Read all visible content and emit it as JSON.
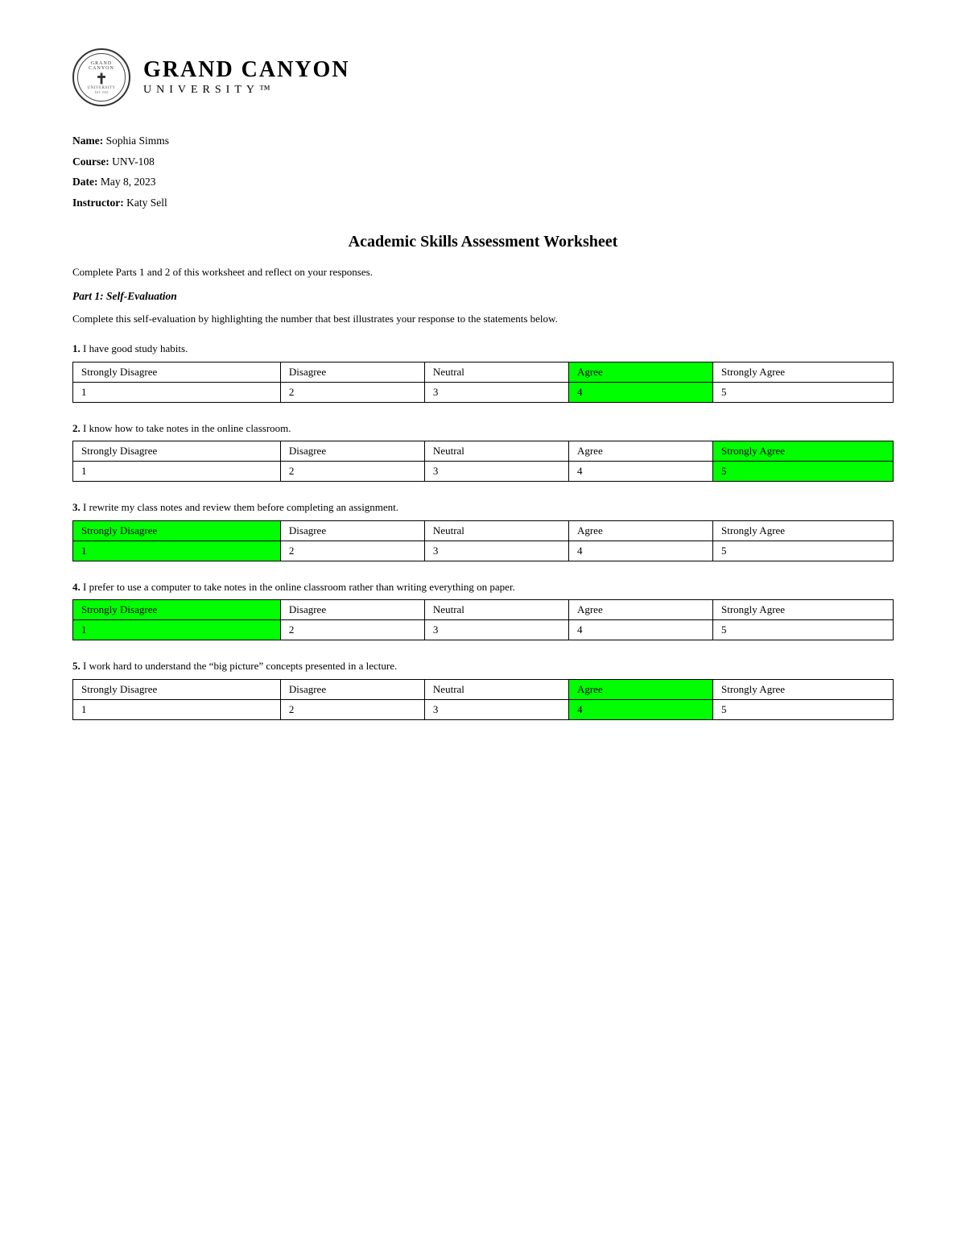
{
  "header": {
    "university_line1": "GRAND CANYON",
    "university_line2": "UNIVERSITY™"
  },
  "meta": {
    "name_label": "Name:",
    "name_value": "Sophia Simms",
    "course_label": "Course:",
    "course_value": "UNV-108",
    "date_label": "Date:",
    "date_value": "May 8, 2023",
    "instructor_label": "Instructor:",
    "instructor_value": "Katy Sell"
  },
  "title": "Academic Skills Assessment Worksheet",
  "instruction": "Complete Parts 1 and 2 of this worksheet and reflect on your responses.",
  "part1": {
    "heading": "Part 1: Self-Evaluation",
    "instruction": "Complete this self-evaluation by highlighting the number that best illustrates your response to the statements below.",
    "questions": [
      {
        "number": "1",
        "text": "I have good study habits.",
        "headers": [
          "Strongly Disagree",
          "Disagree",
          "Neutral",
          "Agree",
          "Strongly Agree"
        ],
        "values": [
          "1",
          "2",
          "3",
          "4",
          "5"
        ],
        "highlighted_header": -1,
        "highlighted_value": 3,
        "header_highlight": 3
      },
      {
        "number": "2",
        "text": "I know how to take notes in the online classroom.",
        "headers": [
          "Strongly Disagree",
          "Disagree",
          "Neutral",
          "Agree",
          "Strongly Agree"
        ],
        "values": [
          "1",
          "2",
          "3",
          "4",
          "5"
        ],
        "highlighted_header": 4,
        "highlighted_value": 4,
        "header_highlight": 4
      },
      {
        "number": "3",
        "text": "I rewrite my class notes and review them before completing an assignment.",
        "headers": [
          "Strongly Disagree",
          "Disagree",
          "Neutral",
          "Agree",
          "Strongly Agree"
        ],
        "values": [
          "1",
          "2",
          "3",
          "4",
          "5"
        ],
        "highlighted_header": 0,
        "highlighted_value": 0,
        "header_highlight": 0
      },
      {
        "number": "4",
        "text": "I prefer to use a computer to take notes in the online classroom rather than writing everything on paper.",
        "headers": [
          "Strongly Disagree",
          "Disagree",
          "Neutral",
          "Agree",
          "Strongly Agree"
        ],
        "values": [
          "1",
          "2",
          "3",
          "4",
          "5"
        ],
        "highlighted_header": 0,
        "highlighted_value": 0,
        "header_highlight": 0
      },
      {
        "number": "5",
        "text": "I work hard to understand the “big picture” concepts presented in a lecture.",
        "headers": [
          "Strongly Disagree",
          "Disagree",
          "Neutral",
          "Agree",
          "Strongly Agree"
        ],
        "values": [
          "1",
          "2",
          "3",
          "4",
          "5"
        ],
        "highlighted_header": -1,
        "highlighted_value": 3,
        "header_highlight": 3
      }
    ]
  }
}
